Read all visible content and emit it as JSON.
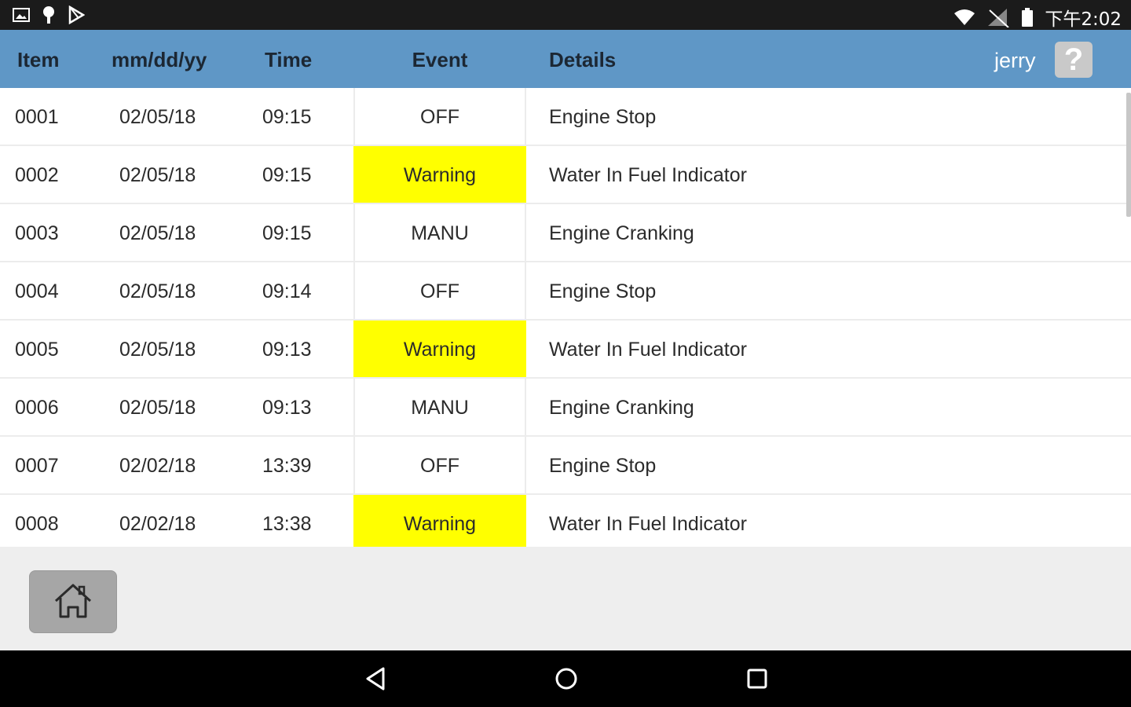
{
  "status_bar": {
    "time": "下午2:02"
  },
  "header": {
    "columns": {
      "item": "Item",
      "date": "mm/dd/yy",
      "time": "Time",
      "event": "Event",
      "details": "Details"
    },
    "user": "jerry",
    "help_label": "?"
  },
  "rows": [
    {
      "item": "0001",
      "date": "02/05/18",
      "time": "09:15",
      "event": "OFF",
      "details": "Engine Stop"
    },
    {
      "item": "0002",
      "date": "02/05/18",
      "time": "09:15",
      "event": "Warning",
      "details": "Water In Fuel Indicator"
    },
    {
      "item": "0003",
      "date": "02/05/18",
      "time": "09:15",
      "event": "MANU",
      "details": "Engine Cranking"
    },
    {
      "item": "0004",
      "date": "02/05/18",
      "time": "09:14",
      "event": "OFF",
      "details": "Engine Stop"
    },
    {
      "item": "0005",
      "date": "02/05/18",
      "time": "09:13",
      "event": "Warning",
      "details": "Water In Fuel Indicator"
    },
    {
      "item": "0006",
      "date": "02/05/18",
      "time": "09:13",
      "event": "MANU",
      "details": "Engine Cranking"
    },
    {
      "item": "0007",
      "date": "02/02/18",
      "time": "13:39",
      "event": "OFF",
      "details": "Engine Stop"
    },
    {
      "item": "0008",
      "date": "02/02/18",
      "time": "13:38",
      "event": "Warning",
      "details": "Water In Fuel Indicator"
    }
  ],
  "colors": {
    "header_bg": "#5f97c6",
    "warning_bg": "#ffff00"
  },
  "icons": {
    "home": "home-icon",
    "help": "help-icon",
    "back": "back-triangle-icon",
    "home_nav": "home-circle-icon",
    "recents": "recents-square-icon"
  }
}
